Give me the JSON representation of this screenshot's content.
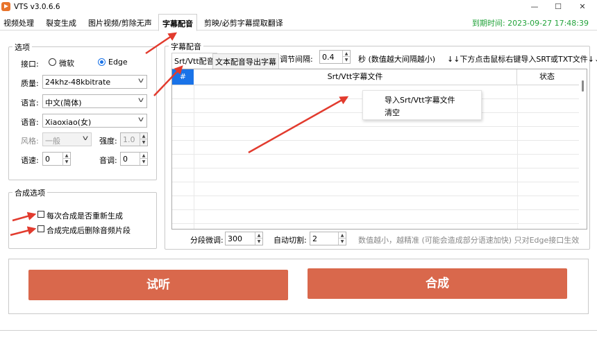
{
  "window": {
    "title": "VTS v3.0.6.6",
    "minimize": "—",
    "maximize": "☐",
    "close": "✕"
  },
  "tabs": [
    "视频处理",
    "裂变生成",
    "图片视频/剪除无声",
    "字幕配音",
    "剪映/必剪字幕提取翻译"
  ],
  "active_tab": "字幕配音",
  "expiry": "到期时间: 2023-09-27 17:48:39",
  "options": {
    "title": "选项",
    "interface_label": "接口:",
    "interface_options": [
      "微软",
      "Edge"
    ],
    "interface_selected": "Edge",
    "quality_label": "质量:",
    "quality_value": "24khz-48kbitrate",
    "language_label": "语言:",
    "language_value": "中文(简体)",
    "voice_label": "语音:",
    "voice_value": "Xiaoxiao(女)",
    "style_label": "风格:",
    "style_value": "一般",
    "intensity_label": "强度:",
    "intensity_value": "1.0",
    "speed_label": "语速:",
    "speed_value": "0",
    "pitch_label": "音调:",
    "pitch_value": "0"
  },
  "synth_options": {
    "title": "合成选项",
    "regen_label": "每次合成是否重新生成",
    "delete_label": "合成完成后删除音频片段"
  },
  "subtitle": {
    "group_title": "字幕配音",
    "tab_srt": "Srt/Vtt配音",
    "tab_text": "文本配音导出字幕",
    "interval_label": "调节间隔:",
    "interval_value": "0.4",
    "interval_hint": "秒 (数值越大间隔越小)",
    "import_hint": "↓↓下方点击鼠标右键导入SRT或TXT文件↓↓",
    "col_num": "#",
    "col_file": "Srt/Vtt字幕文件",
    "col_status": "状态",
    "context_menu": [
      "导入Srt/Vtt字幕文件",
      "清空"
    ],
    "segment_label": "分段微调:",
    "segment_value": "300",
    "autocut_label": "自动切割:",
    "autocut_value": "2",
    "bottom_hint": "数值越小，越精准 (可能会造成部分语速加快) 只对Edge接口生效"
  },
  "buttons": {
    "preview": "试听",
    "synthesize": "合成"
  },
  "colors": {
    "accent": "#1a73e8",
    "button": "#d9684c",
    "expiry": "#22a33a",
    "arrow": "#e23b2e"
  }
}
